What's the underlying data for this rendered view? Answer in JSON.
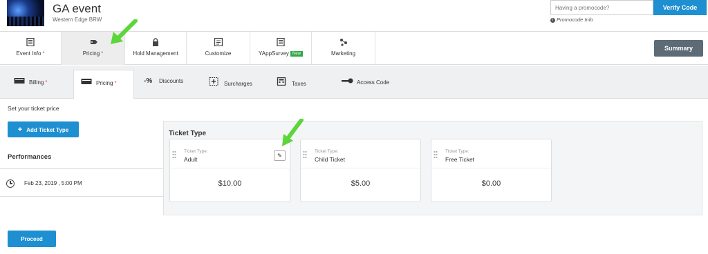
{
  "event": {
    "title": "GA event",
    "venue": "Western Edge BRW"
  },
  "promo": {
    "placeholder": "Having a promocode?",
    "verify_label": "Verify Code",
    "info_label": "Promocode Info"
  },
  "main_tabs": [
    {
      "label": "Event Info",
      "icon": "document-icon",
      "required": "*"
    },
    {
      "label": "Pricing",
      "icon": "tag-icon",
      "required": "*"
    },
    {
      "label": "Hold Management",
      "icon": "lock-icon"
    },
    {
      "label": "Customize",
      "icon": "customize-icon"
    },
    {
      "label": "YAppSurvey",
      "icon": "survey-icon",
      "badge": "New"
    },
    {
      "label": "Marketing",
      "icon": "share-icon"
    }
  ],
  "summary_label": "Summary",
  "sub_tabs": [
    {
      "label": "Billing",
      "icon": "ticket-icon",
      "required": "*"
    },
    {
      "label": "Pricing",
      "icon": "ticket-icon",
      "required": "*"
    },
    {
      "label": "Discounts",
      "icon": "percent-icon",
      "icon_text": "-%"
    },
    {
      "label": "Surcharges",
      "icon": "plus-box-icon"
    },
    {
      "label": "Taxes",
      "icon": "calculator-icon"
    },
    {
      "label": "Access Code",
      "icon": "key-icon"
    }
  ],
  "content": {
    "set_price_label": "Set your ticket price",
    "add_ticket_label": "Add Ticket Type",
    "add_ticket_icon": "+",
    "performances_label": "Performances",
    "performance_date": "Feb 23, 2019 , 5:00 PM",
    "ticket_type_heading": "Ticket Type",
    "proceed_label": "Proceed"
  },
  "tickets": [
    {
      "type_label": "Ticket Type:",
      "name": "Adult",
      "price": "$10.00"
    },
    {
      "type_label": "Ticket Type:",
      "name": "Child Ticket",
      "price": "$5.00"
    },
    {
      "type_label": "Ticket Type:",
      "name": "Free Ticket",
      "price": "$0.00"
    }
  ],
  "colors": {
    "primary": "#1e8fd1",
    "summary": "#5c6b75",
    "arrow": "#5cd63a",
    "required": "#d9534f",
    "new_badge": "#2fa94b"
  }
}
